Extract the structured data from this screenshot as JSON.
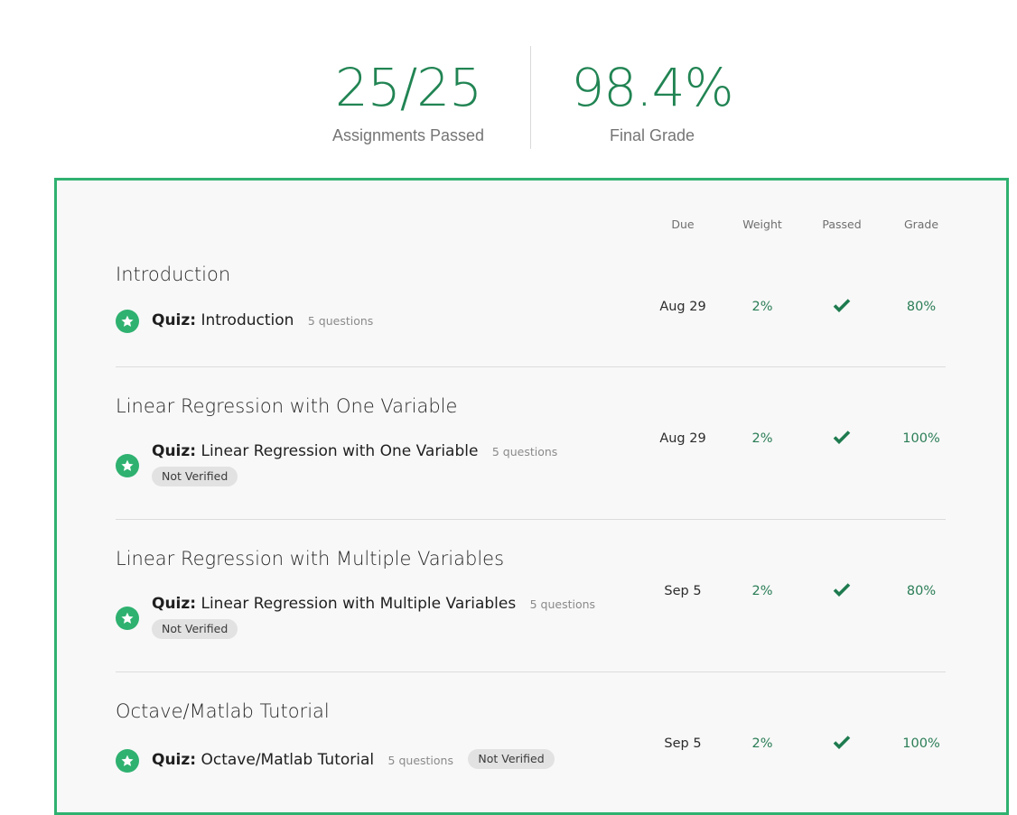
{
  "summary": {
    "assignments_value": "25/25",
    "assignments_label": "Assignments Passed",
    "grade_value": "98.4%",
    "grade_label": "Final Grade"
  },
  "columns": {
    "due": "Due",
    "weight": "Weight",
    "passed": "Passed",
    "grade": "Grade"
  },
  "modules": [
    {
      "title": "Introduction",
      "item_kind": "Quiz:",
      "item_name": "Introduction",
      "questions": "5 questions",
      "badge": "",
      "due": "Aug 29",
      "weight": "2%",
      "passed": "check-icon",
      "grade": "80%"
    },
    {
      "title": "Linear Regression with One Variable",
      "item_kind": "Quiz:",
      "item_name": "Linear Regression with One Variable",
      "questions": "5 questions",
      "badge": "Not Verified",
      "due": "Aug 29",
      "weight": "2%",
      "passed": "check-icon",
      "grade": "100%"
    },
    {
      "title": "Linear Regression with Multiple Variables",
      "item_kind": "Quiz:",
      "item_name": "Linear Regression with Multiple Variables",
      "questions": "5 questions",
      "badge": "Not Verified",
      "due": "Sep 5",
      "weight": "2%",
      "passed": "check-icon",
      "grade": "80%"
    },
    {
      "title": "Octave/Matlab Tutorial",
      "item_kind": "Quiz:",
      "item_name": "Octave/Matlab Tutorial",
      "questions": "5 questions",
      "badge": "Not Verified",
      "due": "Sep 5",
      "weight": "2%",
      "passed": "check-icon",
      "grade": "100%"
    }
  ],
  "colors": {
    "accent": "#2fb170",
    "value_green": "#218453",
    "check_green": "#1e7b4f"
  }
}
